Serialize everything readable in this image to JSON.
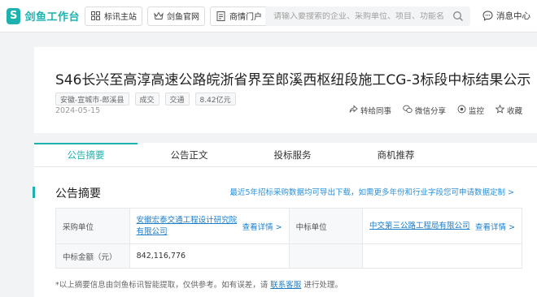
{
  "app": {
    "logo_glyph": "S",
    "name": "剑鱼工作台",
    "brand_color": "#1eb2ae"
  },
  "nav": [
    {
      "icon": "grid-icon",
      "label": "标讯主站"
    },
    {
      "icon": "crown-icon",
      "label": "剑鱼官网"
    },
    {
      "icon": "document-icon",
      "label": "商情门户"
    }
  ],
  "search": {
    "placeholder": "请输入要搜索的企业、采购单位、项目、功能名称"
  },
  "messages": {
    "label": "消息中心"
  },
  "notice": {
    "title": "S46长兴至高淳高速公路皖浙省界至郎溪西枢纽段施工CG-3标段中标结果公示",
    "tags": [
      "安徽-宣城市-郎溪县",
      "成交",
      "交通",
      "8.42亿元"
    ],
    "date": "2024-05-15",
    "actions": [
      {
        "icon": "share-icon",
        "label": "转给同事"
      },
      {
        "icon": "wechat-icon",
        "label": "微信分享"
      },
      {
        "icon": "monitor-icon",
        "label": "监控"
      },
      {
        "icon": "star-icon",
        "label": "收藏"
      }
    ]
  },
  "tabs": [
    "公告摘要",
    "公告正文",
    "投标服务",
    "商机推荐"
  ],
  "summary": {
    "title": "公告摘要",
    "note": "最近5年招标采购数据均可导出下载，如需更多年份和行业字段您可申请数据定制 >",
    "rows": {
      "buyer_label": "采购单位",
      "buyer_value": "安徽宏泰交通工程设计研究院有限公司",
      "buyer_more": "查看详情 >",
      "winner_label": "中标单位",
      "winner_value": "中交第三公路工程局有限公司",
      "winner_more": "查看详情 >",
      "amount_label": "中标金额（元）",
      "amount_value": "842,116,776"
    },
    "disclaimer_pre": "*以上摘要信息由剑鱼标讯智能提取，仅供参考。如有误差，请 ",
    "disclaimer_link": "联系客服",
    "disclaimer_post": " 进行处理。"
  }
}
